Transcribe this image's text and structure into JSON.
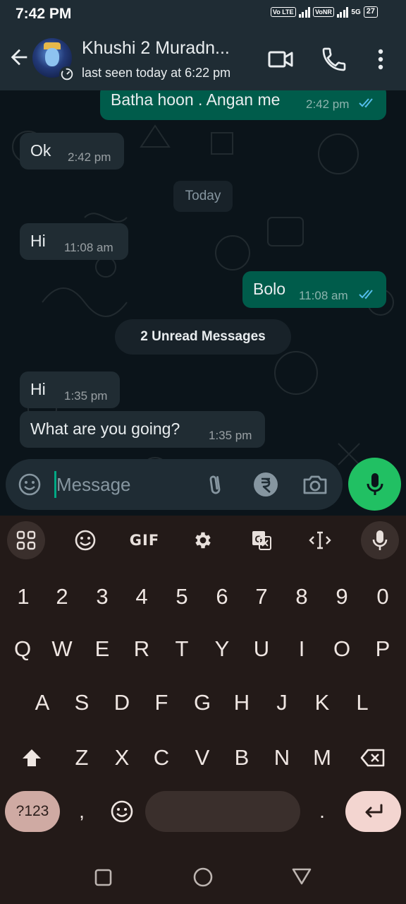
{
  "status_bar": {
    "time": "7:42 PM",
    "volte_label": "Vo LTE",
    "vonr_label": "VoNR",
    "network": "5G",
    "battery": "27"
  },
  "header": {
    "contact_name": "Khushi 2 Muradn...",
    "last_seen": "last seen today at 6:22 pm",
    "icons": [
      "back-arrow",
      "video-call",
      "voice-call",
      "more-vertical"
    ]
  },
  "chat": {
    "messages": [
      {
        "direction": "out",
        "text": "Batha hoon . Angan me",
        "time": "2:42 pm",
        "status": "read"
      },
      {
        "direction": "in",
        "text": "Ok",
        "time": "2:42 pm"
      },
      {
        "direction": "in",
        "text": "Hi",
        "time": "11:08 am"
      },
      {
        "direction": "out",
        "text": "Bolo",
        "time": "11:08 am",
        "status": "read"
      },
      {
        "direction": "in",
        "text": "Hi",
        "time": "1:35 pm"
      },
      {
        "direction": "in",
        "text": "What are you going?",
        "time": "1:35 pm"
      }
    ],
    "date_divider": "Today",
    "unread_divider": "2 Unread Messages"
  },
  "composer": {
    "placeholder": "Message",
    "value": "",
    "icons": [
      "emoji",
      "attach",
      "rupee",
      "camera",
      "mic"
    ]
  },
  "keyboard": {
    "toolbar": [
      "apps-grid",
      "emoji",
      "GIF",
      "settings",
      "translate",
      "cursor-move",
      "mic"
    ],
    "gif_label": "GIF",
    "number_row": [
      "1",
      "2",
      "3",
      "4",
      "5",
      "6",
      "7",
      "8",
      "9",
      "0"
    ],
    "row1": [
      "Q",
      "W",
      "E",
      "R",
      "T",
      "Y",
      "U",
      "I",
      "O",
      "P"
    ],
    "row2": [
      "A",
      "S",
      "D",
      "F",
      "G",
      "H",
      "J",
      "K",
      "L"
    ],
    "row3": [
      "Z",
      "X",
      "C",
      "V",
      "B",
      "N",
      "M"
    ],
    "symbols_label": "?123",
    "comma": ",",
    "period": "."
  },
  "colors": {
    "background": "#0b141a",
    "header": "#1f2c34",
    "incoming_bubble": "#202c33",
    "outgoing_bubble": "#005c4b",
    "accent_green": "#21c063",
    "read_ticks": "#53bdeb",
    "keyboard_bg": "#231a18",
    "enter_key": "#f3d5d0",
    "symbols_key": "#cfaaa3"
  }
}
